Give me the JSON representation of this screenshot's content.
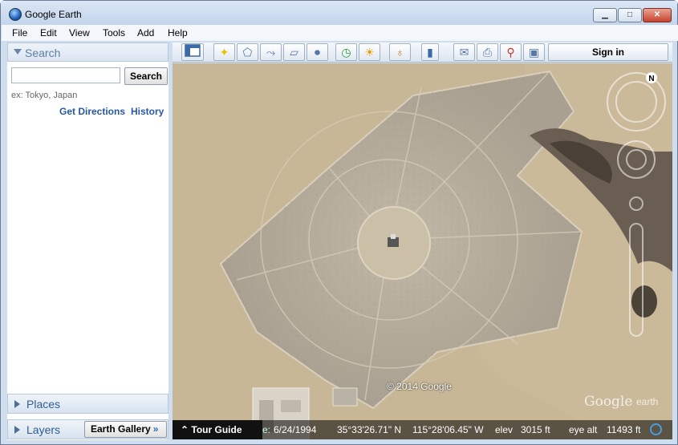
{
  "window": {
    "title": "Google Earth",
    "controls": {
      "minimize": "▁",
      "maximize": "□",
      "close": "✕"
    }
  },
  "menu": [
    "File",
    "Edit",
    "View",
    "Tools",
    "Add",
    "Help"
  ],
  "search": {
    "title": "Search",
    "button": "Search",
    "placeholder": "",
    "hint": "ex: Tokyo, Japan",
    "directions": "Get Directions",
    "history": "History"
  },
  "panels": {
    "places": "Places",
    "layers": "Layers",
    "earth_gallery": "Earth Gallery"
  },
  "toolbar": {
    "sign_in": "Sign in",
    "icons": [
      "sidebar-toggle-icon",
      "placemark-icon",
      "polygon-icon",
      "path-icon",
      "image-overlay-icon",
      "record-tour-icon",
      "historical-imagery-icon",
      "sunlight-icon",
      "planet-icon",
      "ruler-icon",
      "email-icon",
      "print-icon",
      "view-in-maps-icon",
      "save-image-icon"
    ]
  },
  "map": {
    "copyright": "© 2014 Google",
    "logo": "Google",
    "logo_suffix": "earth",
    "compass": "N"
  },
  "status": {
    "tour_guide": "Tour Guide",
    "date": "6/24/1994",
    "lat": "35°33'26.71\" N",
    "lon": "115°28'06.45\" W",
    "elev_label": "elev",
    "elev": "3015 ft",
    "eye_label": "eye alt",
    "eye": "11493 ft"
  },
  "colors": {
    "accent": "#2f5d94",
    "link": "#2657a6",
    "terrain": "#c9b89a"
  }
}
